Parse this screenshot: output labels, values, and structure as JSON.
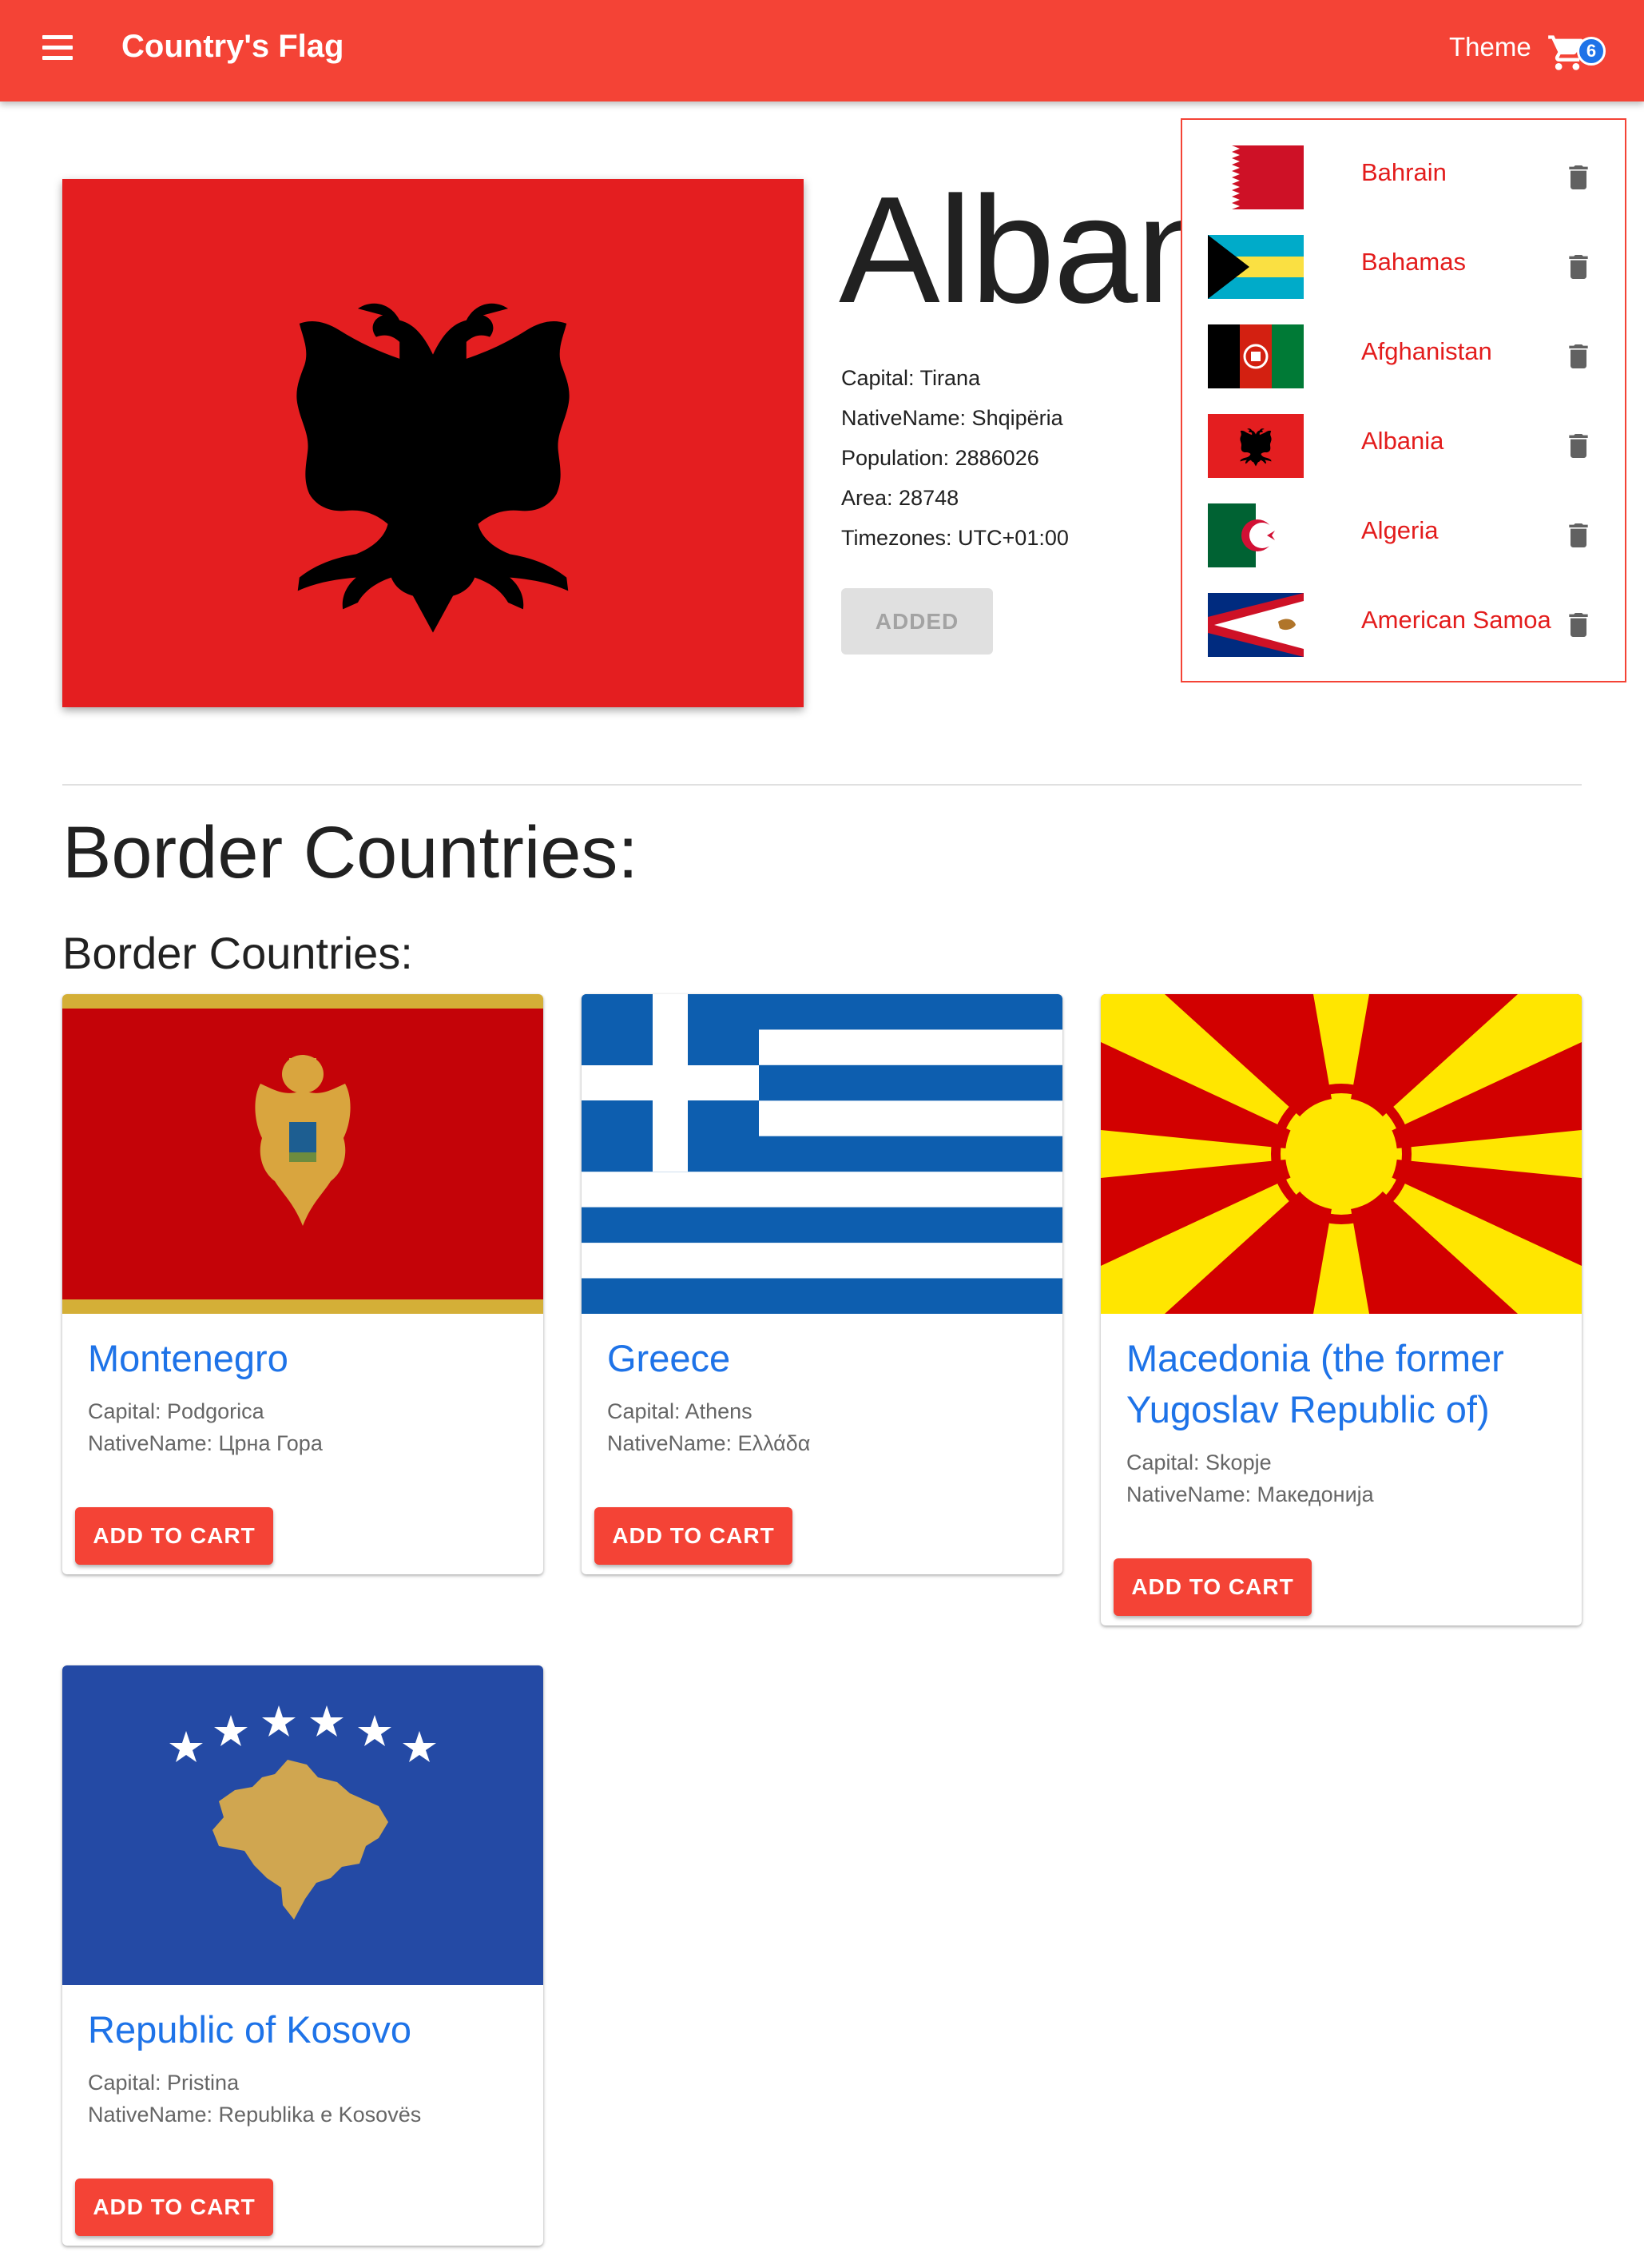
{
  "app_bar": {
    "title": "Country's Flag",
    "theme_label": "Theme",
    "cart_count": "6",
    "background_color": "#f44336",
    "badge_color": "#1e73e8"
  },
  "country": {
    "name": "Albania",
    "details": [
      "Capital: Tirana",
      "NativeName: Shqipëria",
      "Population: 2886026",
      "Area: 28748",
      "Timezones: UTC+01:00"
    ],
    "added_label": "ADDED"
  },
  "cart": {
    "items": [
      {
        "name": "Bahrain",
        "flag": "bahrain-flag"
      },
      {
        "name": "Bahamas",
        "flag": "bahamas-flag"
      },
      {
        "name": "Afghanistan",
        "flag": "afghanistan-flag"
      },
      {
        "name": "Albania",
        "flag": "albania-flag"
      },
      {
        "name": "Algeria",
        "flag": "algeria-flag"
      },
      {
        "name": "American Samoa",
        "flag": "american-samoa-flag"
      }
    ],
    "delete_icon": "trash-icon"
  },
  "border": {
    "heading": "Border Countries:",
    "subheading": "Border Countries:",
    "add_label": "ADD TO CART",
    "countries": [
      {
        "name": "Montenegro",
        "capital": "Capital: Podgorica",
        "native": "NativeName: Црна Гора"
      },
      {
        "name": "Greece",
        "capital": "Capital: Athens",
        "native": "NativeName: Ελλάδα"
      },
      {
        "name": "Macedonia (the former Yugoslav Republic of)",
        "capital": "Capital: Skopje",
        "native": "NativeName: Македонија"
      },
      {
        "name": "Republic of Kosovo",
        "capital": "Capital: Pristina",
        "native": "NativeName: Republika e Kosovës"
      }
    ]
  },
  "colors": {
    "accent": "#f44336",
    "link": "#1e73e8",
    "cart_text": "#e31c1c"
  }
}
